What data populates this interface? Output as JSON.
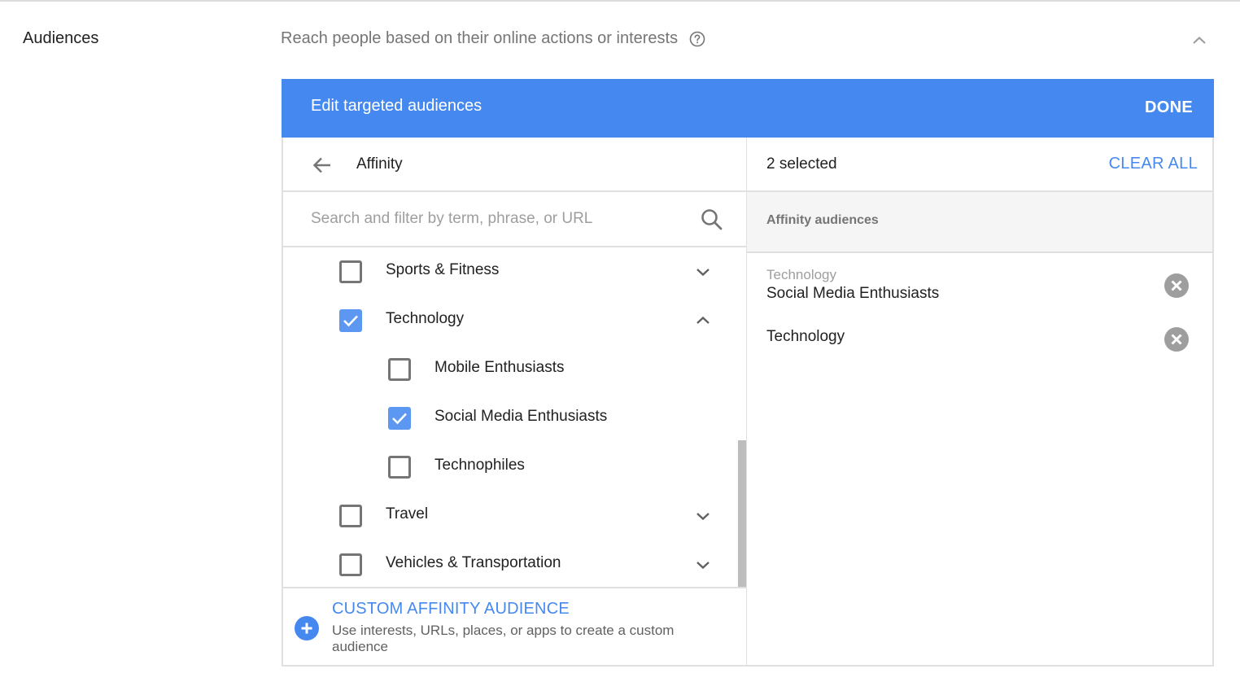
{
  "section": {
    "label": "Audiences",
    "subtitle": "Reach people based on their online actions or interests",
    "help_icon": "help-circle-icon",
    "collapse_icon": "chevron-up-icon"
  },
  "editor": {
    "title": "Edit targeted audiences",
    "done_label": "DONE",
    "accent_color": "#4589f0"
  },
  "browse": {
    "back_icon": "arrow-back-icon",
    "title": "Affinity",
    "search_placeholder": "Search and filter by term, phrase, or URL",
    "search_value": "",
    "items": [
      {
        "label": "Sports & Fitness",
        "checked": false,
        "level": 0,
        "expand": "chevron-down"
      },
      {
        "label": "Technology",
        "checked": true,
        "level": 0,
        "expand": "chevron-up"
      },
      {
        "label": "Mobile Enthusiasts",
        "checked": false,
        "level": 1,
        "expand": null
      },
      {
        "label": "Social Media Enthusiasts",
        "checked": true,
        "level": 1,
        "expand": null
      },
      {
        "label": "Technophiles",
        "checked": false,
        "level": 1,
        "expand": null
      },
      {
        "label": "Travel",
        "checked": false,
        "level": 0,
        "expand": "chevron-down"
      },
      {
        "label": "Vehicles & Transportation",
        "checked": false,
        "level": 0,
        "expand": "chevron-down"
      }
    ],
    "footer": {
      "title": "CUSTOM AFFINITY AUDIENCE",
      "description": "Use interests, URLs, places, or apps to create a custom audience"
    }
  },
  "selected": {
    "count_label": "2 selected",
    "clear_label": "CLEAR ALL",
    "group_label": "Affinity audiences",
    "items": [
      {
        "parent": "Technology",
        "name": "Social Media Enthusiasts"
      },
      {
        "parent": "",
        "name": "Technology"
      }
    ]
  }
}
